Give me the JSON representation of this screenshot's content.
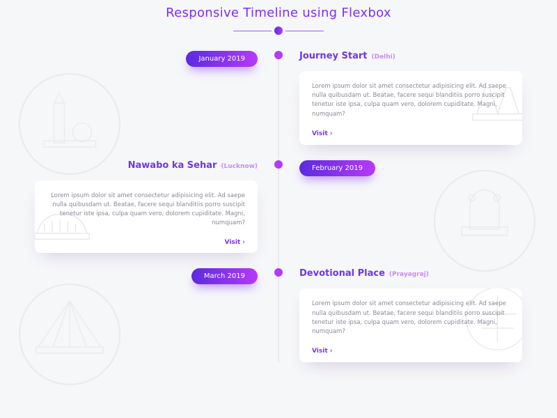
{
  "header": {
    "title": "Responsive Timeline using Flexbox"
  },
  "link_label": "Visit ›",
  "body_text": "Lorem ipsum dolor sit amet consectetur adipisicing elit. Ad saepe nulla quibusdam ut. Beatae, facere sequi blanditiis porro suscipit tenetur iste ipsa, culpa quam vero, dolorem cupiditate. Magni, numquam?",
  "events": [
    {
      "date": "January 2019",
      "title": "Journey Start",
      "location": "(Delhi)",
      "side": "right"
    },
    {
      "date": "February 2019",
      "title": "Nawabo ka Sehar",
      "location": "(Lucknow)",
      "side": "left"
    },
    {
      "date": "March 2019",
      "title": "Devotional Place",
      "location": "(Prayagraj)",
      "side": "right"
    }
  ]
}
